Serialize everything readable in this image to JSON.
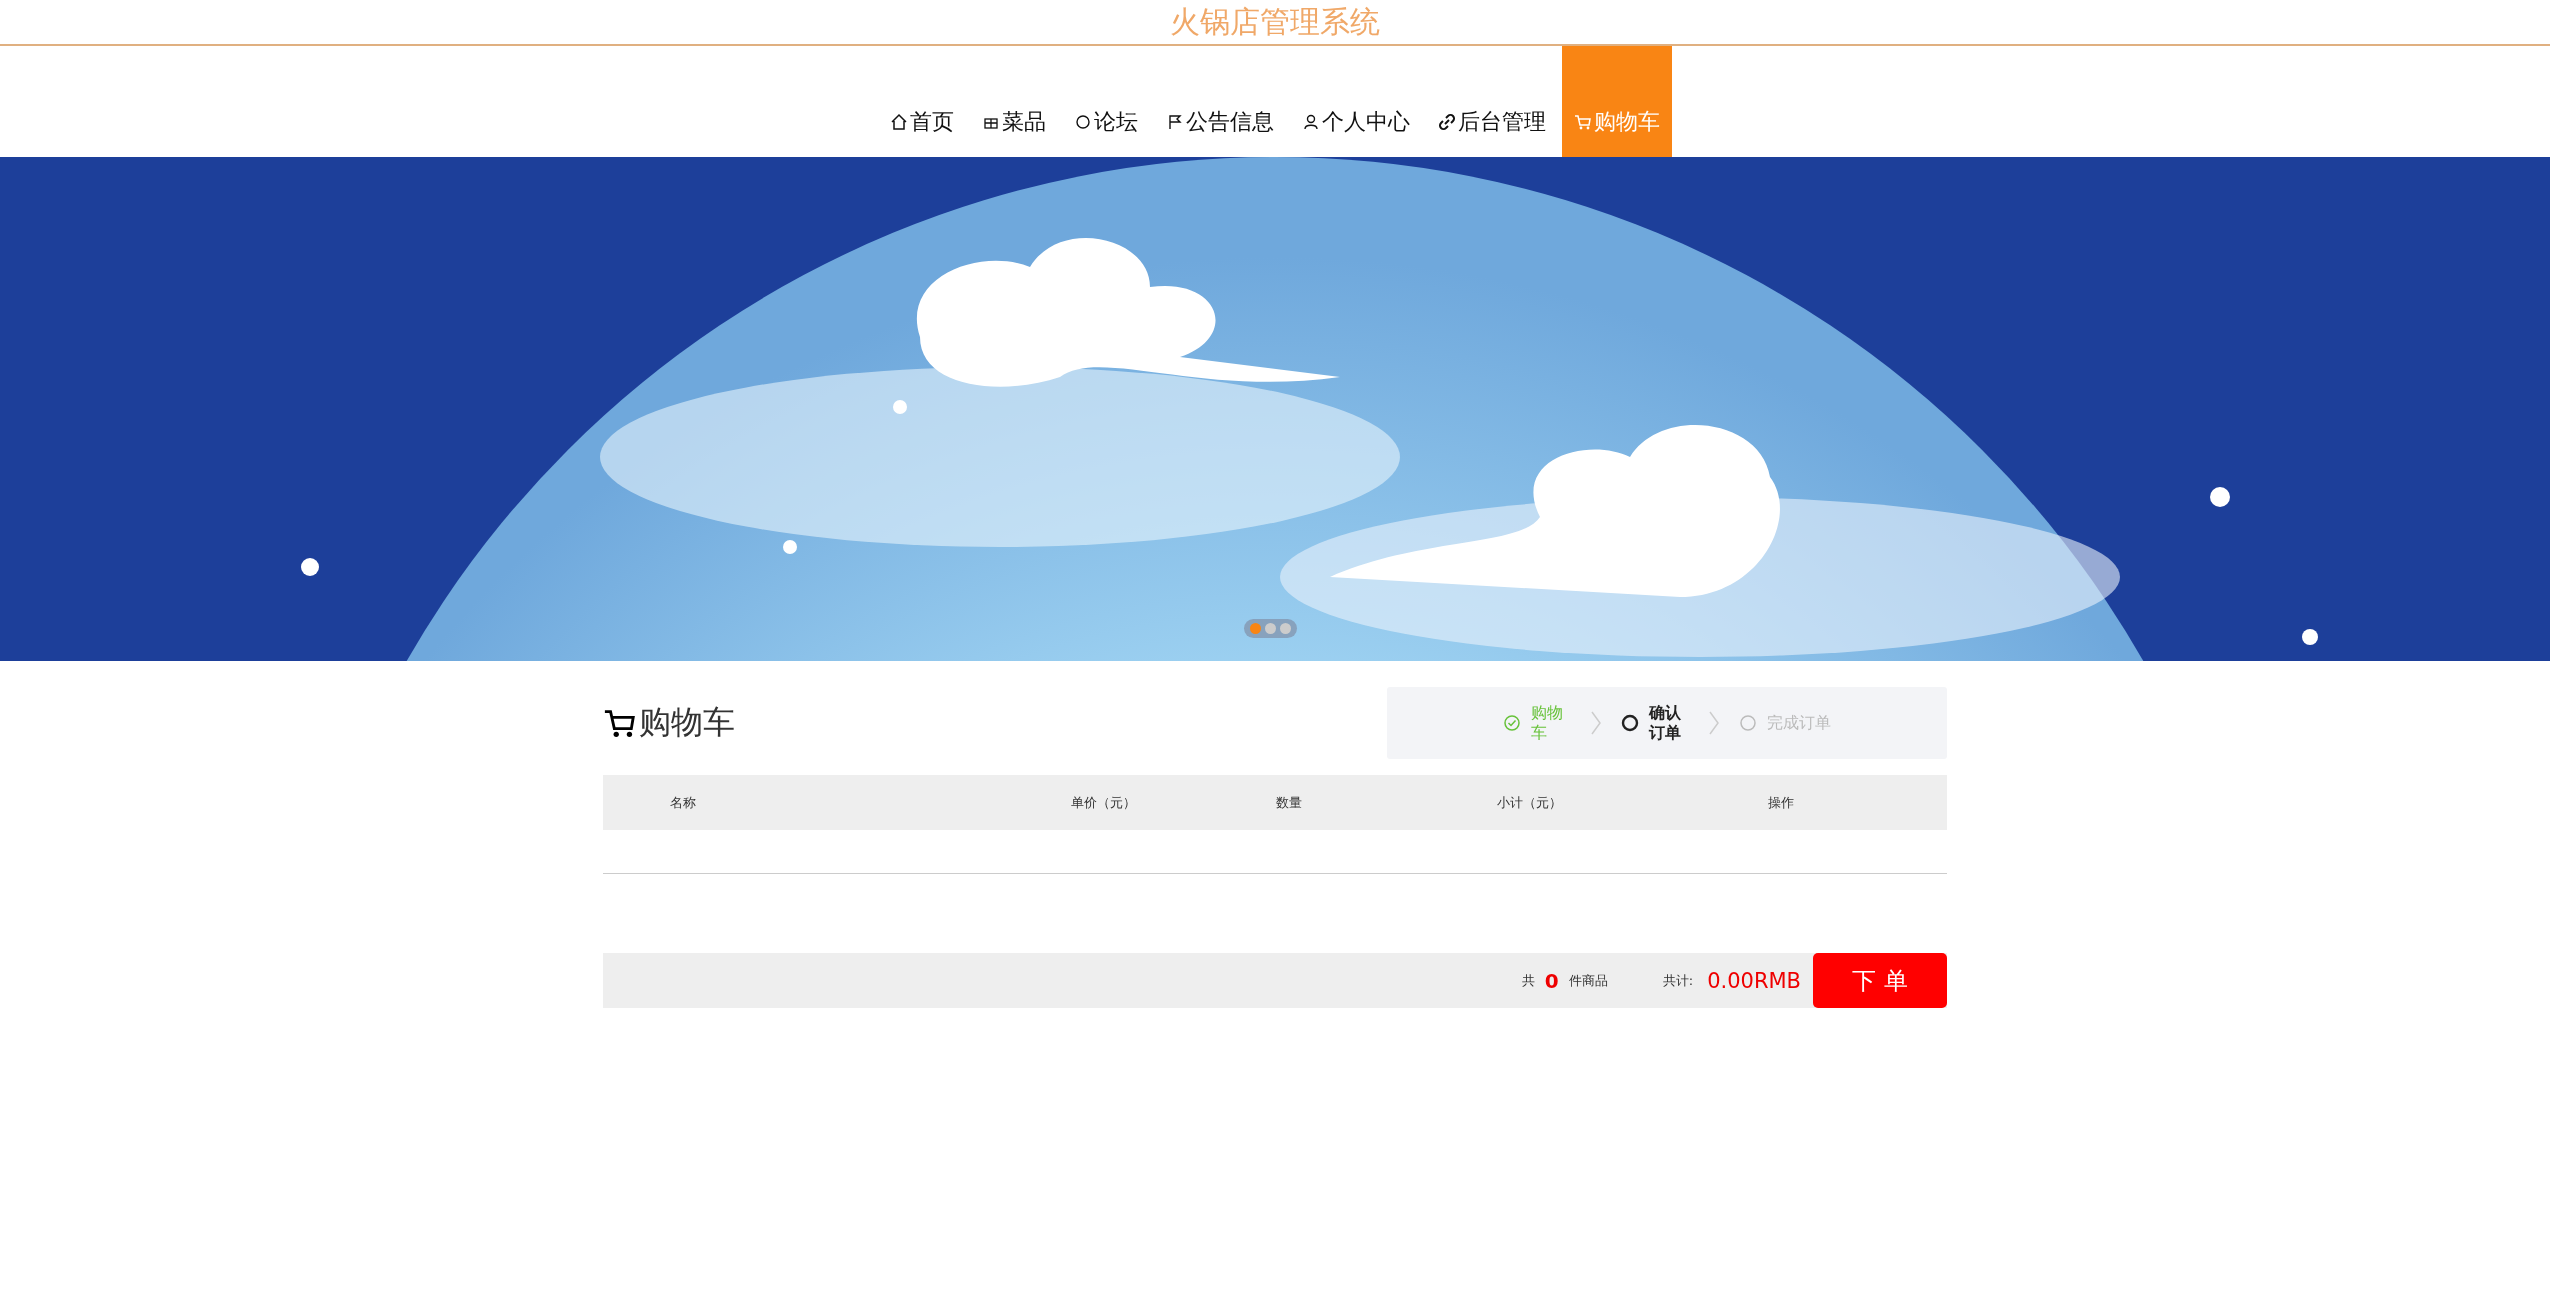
{
  "site_title": "火锅店管理系统",
  "nav": [
    {
      "label": "首页",
      "selected": false
    },
    {
      "label": "菜品",
      "selected": false
    },
    {
      "label": "论坛",
      "selected": false
    },
    {
      "label": "公告信息",
      "selected": false
    },
    {
      "label": "个人中心",
      "selected": false
    },
    {
      "label": "后台管理",
      "selected": false
    },
    {
      "label": "购物车",
      "selected": true
    }
  ],
  "banner": {
    "kind": "picture",
    "dots": [
      {
        "selected": true
      },
      {
        "selected": false
      },
      {
        "selected": false
      }
    ]
  },
  "cart": {
    "heading": "购物车",
    "steps": [
      {
        "label": "购物车",
        "done": true,
        "selected": false
      },
      {
        "label": "确认订单",
        "done": false,
        "selected": true
      },
      {
        "label": "完成订单",
        "done": false,
        "selected": false
      }
    ],
    "columns": [
      "名称",
      "单价（元）",
      "数量",
      "小计（元）",
      "操作"
    ],
    "summary": {
      "count_prefix": "共",
      "count": "0",
      "count_suffix": "件商品",
      "total_label": "共计:",
      "total": "0.00RMB",
      "order_button": "下 单"
    }
  }
}
